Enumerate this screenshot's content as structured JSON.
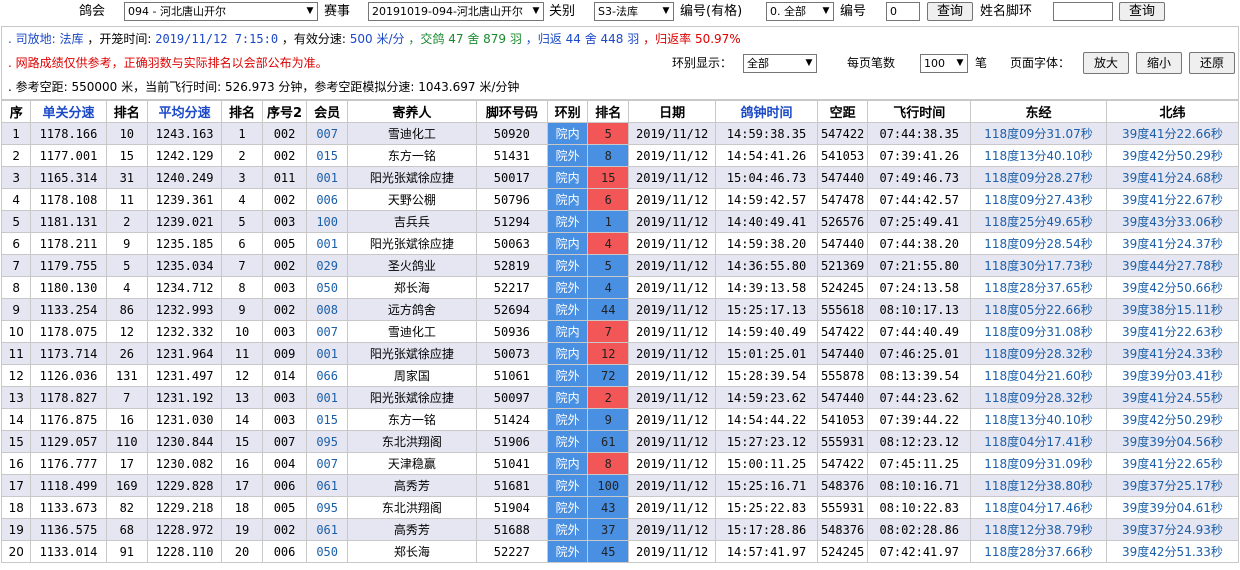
{
  "filter": {
    "club_label": "鸽会",
    "club_value": "094 - 河北唐山开尔",
    "race_label": "赛事",
    "race_value": "20191019-094-河北唐山开尔",
    "stage_label": "关别",
    "stage_value": "S3-法库",
    "number_label": "编号(有格)",
    "number_select": "0. 全部",
    "number2_label": "编号",
    "number2_value": "0",
    "query_label": "查询",
    "name_label": "姓名脚环",
    "name_value": "",
    "query2_label": "查询"
  },
  "info": {
    "prefix1": ". 司放地:",
    "release_site": "法库",
    "release_time_label": "，开笼时间:",
    "release_time": "2019/11/12 7:15:0",
    "speed_label": "，有效分速:",
    "speed": "500 米/分",
    "homing_label": "，交鸽",
    "homing_lofts": "47",
    "lofts_unit": "舍",
    "homing_birds": "879",
    "birds_unit": "羽",
    "return_label": "，归返",
    "return_lofts": "44",
    "return_lofts_unit": "舍",
    "return_birds": "448",
    "return_birds_unit": "羽",
    "rate_label": "，归返率",
    "rate": "50.97%",
    "notice": ". 网路成绩仅供参考，正确羽数与实际排名以会部公布为准。",
    "ring_display_label": "环别显示：",
    "ring_display_value": "全部",
    "per_page_label": "每页笔数",
    "per_page_value": "100",
    "per_page_unit": "笔",
    "font_label": "页面字体：",
    "zoom_in": "放大",
    "zoom_out": "缩小",
    "reset": "还原",
    "ref": ". 参考空距: 550000 米，当前飞行时间: 526.973 分钟，参考空距模拟分速: 1043.697 米/分钟"
  },
  "table": {
    "headers": [
      "序",
      "单关分速",
      "排名",
      "平均分速",
      "排名",
      "序号2",
      "会员",
      "寄养人",
      "脚环号码",
      "环别",
      "排名",
      "日期",
      "鸽钟时间",
      "空距",
      "飞行时间",
      "东经",
      "北纬"
    ],
    "rows": [
      [
        "1",
        "1178.166",
        "10",
        "1243.163",
        "1",
        "002",
        "007",
        "雪迪化工",
        "50920",
        "院内",
        "5",
        "2019/11/12",
        "14:59:38.35",
        "547422",
        "07:44:38.35",
        "118度09分31.07秒",
        "39度41分22.66秒"
      ],
      [
        "2",
        "1177.001",
        "15",
        "1242.129",
        "2",
        "002",
        "015",
        "东方一铭",
        "51431",
        "院外",
        "8",
        "2019/11/12",
        "14:54:41.26",
        "541053",
        "07:39:41.26",
        "118度13分40.10秒",
        "39度42分50.29秒"
      ],
      [
        "3",
        "1165.314",
        "31",
        "1240.249",
        "3",
        "011",
        "001",
        "阳光张斌徐应捷",
        "50017",
        "院内",
        "15",
        "2019/11/12",
        "15:04:46.73",
        "547440",
        "07:49:46.73",
        "118度09分28.27秒",
        "39度41分24.68秒"
      ],
      [
        "4",
        "1178.108",
        "11",
        "1239.361",
        "4",
        "002",
        "006",
        "天野公棚",
        "50796",
        "院内",
        "6",
        "2019/11/12",
        "14:59:42.57",
        "547478",
        "07:44:42.57",
        "118度09分27.43秒",
        "39度41分22.67秒"
      ],
      [
        "5",
        "1181.131",
        "2",
        "1239.021",
        "5",
        "003",
        "100",
        "吉兵兵",
        "51294",
        "院外",
        "1",
        "2019/11/12",
        "14:40:49.41",
        "526576",
        "07:25:49.41",
        "118度25分49.65秒",
        "39度43分33.06秒"
      ],
      [
        "6",
        "1178.211",
        "9",
        "1235.185",
        "6",
        "005",
        "001",
        "阳光张斌徐应捷",
        "50063",
        "院内",
        "4",
        "2019/11/12",
        "14:59:38.20",
        "547440",
        "07:44:38.20",
        "118度09分28.54秒",
        "39度41分24.37秒"
      ],
      [
        "7",
        "1179.755",
        "5",
        "1235.034",
        "7",
        "002",
        "029",
        "圣火鸽业",
        "52819",
        "院外",
        "5",
        "2019/11/12",
        "14:36:55.80",
        "521369",
        "07:21:55.80",
        "118度30分17.73秒",
        "39度44分27.78秒"
      ],
      [
        "8",
        "1180.130",
        "4",
        "1234.712",
        "8",
        "003",
        "050",
        "郑长海",
        "52217",
        "院外",
        "4",
        "2019/11/12",
        "14:39:13.58",
        "524245",
        "07:24:13.58",
        "118度28分37.65秒",
        "39度42分50.66秒"
      ],
      [
        "9",
        "1133.254",
        "86",
        "1232.993",
        "9",
        "002",
        "008",
        "远方鸽舍",
        "52694",
        "院外",
        "44",
        "2019/11/12",
        "15:25:17.13",
        "555618",
        "08:10:17.13",
        "118度05分22.66秒",
        "39度38分15.11秒"
      ],
      [
        "10",
        "1178.075",
        "12",
        "1232.332",
        "10",
        "003",
        "007",
        "雪迪化工",
        "50936",
        "院内",
        "7",
        "2019/11/12",
        "14:59:40.49",
        "547422",
        "07:44:40.49",
        "118度09分31.08秒",
        "39度41分22.63秒"
      ],
      [
        "11",
        "1173.714",
        "26",
        "1231.964",
        "11",
        "009",
        "001",
        "阳光张斌徐应捷",
        "50073",
        "院内",
        "12",
        "2019/11/12",
        "15:01:25.01",
        "547440",
        "07:46:25.01",
        "118度09分28.32秒",
        "39度41分24.33秒"
      ],
      [
        "12",
        "1126.036",
        "131",
        "1231.497",
        "12",
        "014",
        "066",
        "周家国",
        "51061",
        "院外",
        "72",
        "2019/11/12",
        "15:28:39.54",
        "555878",
        "08:13:39.54",
        "118度04分21.60秒",
        "39度39分03.41秒"
      ],
      [
        "13",
        "1178.827",
        "7",
        "1231.192",
        "13",
        "003",
        "001",
        "阳光张斌徐应捷",
        "50097",
        "院内",
        "2",
        "2019/11/12",
        "14:59:23.62",
        "547440",
        "07:44:23.62",
        "118度09分28.32秒",
        "39度41分24.55秒"
      ],
      [
        "14",
        "1176.875",
        "16",
        "1231.030",
        "14",
        "003",
        "015",
        "东方一铭",
        "51424",
        "院外",
        "9",
        "2019/11/12",
        "14:54:44.22",
        "541053",
        "07:39:44.22",
        "118度13分40.10秒",
        "39度42分50.29秒"
      ],
      [
        "15",
        "1129.057",
        "110",
        "1230.844",
        "15",
        "007",
        "095",
        "东北洪翔阁",
        "51906",
        "院外",
        "61",
        "2019/11/12",
        "15:27:23.12",
        "555931",
        "08:12:23.12",
        "118度04分17.41秒",
        "39度39分04.56秒"
      ],
      [
        "16",
        "1176.777",
        "17",
        "1230.082",
        "16",
        "004",
        "007",
        "天津稳赢",
        "51041",
        "院内",
        "8",
        "2019/11/12",
        "15:00:11.25",
        "547422",
        "07:45:11.25",
        "118度09分31.09秒",
        "39度41分22.65秒"
      ],
      [
        "17",
        "1118.499",
        "169",
        "1229.828",
        "17",
        "006",
        "061",
        "高秀芳",
        "51681",
        "院外",
        "100",
        "2019/11/12",
        "15:25:16.71",
        "548376",
        "08:10:16.71",
        "118度12分38.80秒",
        "39度37分25.17秒"
      ],
      [
        "18",
        "1133.673",
        "82",
        "1229.218",
        "18",
        "005",
        "095",
        "东北洪翔阁",
        "51904",
        "院外",
        "43",
        "2019/11/12",
        "15:25:22.83",
        "555931",
        "08:10:22.83",
        "118度04分17.46秒",
        "39度39分04.61秒"
      ],
      [
        "19",
        "1136.575",
        "68",
        "1228.972",
        "19",
        "002",
        "061",
        "高秀芳",
        "51688",
        "院外",
        "37",
        "2019/11/12",
        "15:17:28.86",
        "548376",
        "08:02:28.86",
        "118度12分38.79秒",
        "39度37分24.93秒"
      ],
      [
        "20",
        "1133.014",
        "91",
        "1228.110",
        "20",
        "006",
        "050",
        "郑长海",
        "52227",
        "院外",
        "45",
        "2019/11/12",
        "14:57:41.97",
        "524245",
        "07:42:41.97",
        "118度28分37.66秒",
        "39度42分51.33秒"
      ]
    ]
  }
}
